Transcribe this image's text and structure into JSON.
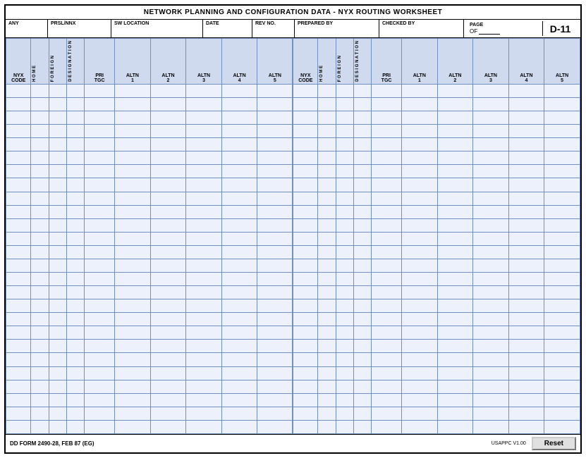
{
  "title": "NETWORK PLANNING AND CONFIGURATION DATA - NYX ROUTING WORKSHEET",
  "header": {
    "any_label": "ANY",
    "prsl_label": "PRSL/NNX",
    "sw_label": "SW LOCATION",
    "date_label": "DATE",
    "rev_label": "REV NO.",
    "prep_label": "PREPARED BY",
    "check_label": "CHECKED BY",
    "page_label": "PAGE",
    "of_label": "OF",
    "page_id": "D-11"
  },
  "columns_left": {
    "nyx_code": "NYX CODE",
    "home": "H O M E",
    "foreign": "F O R E I G N",
    "desig": "D E S I G N A T I O N",
    "pri_tgc": "PRI TGC",
    "altn1": "ALTN 1",
    "altn2": "ALTN 2",
    "altn3": "ALTN 3",
    "altn4": "ALTN 4",
    "altn5": "ALTN 5"
  },
  "columns_right": {
    "nyx_code": "NYX CODE",
    "home": "H O M E",
    "foreign": "F O R E I G N",
    "desig": "D E S I G N A T I O N",
    "pri_tgc": "PRI TGC",
    "altn1": "ALTN 1",
    "altn2": "ALTN 2",
    "altn3": "ALTN 3",
    "altn4": "ALTN 4",
    "altn5": "ALTN 5"
  },
  "footer": {
    "form_name": "DD FORM 2490-28, FEB 87 (EG)",
    "version": "USAPPC V1.00",
    "reset_label": "Reset"
  },
  "rows": 26
}
